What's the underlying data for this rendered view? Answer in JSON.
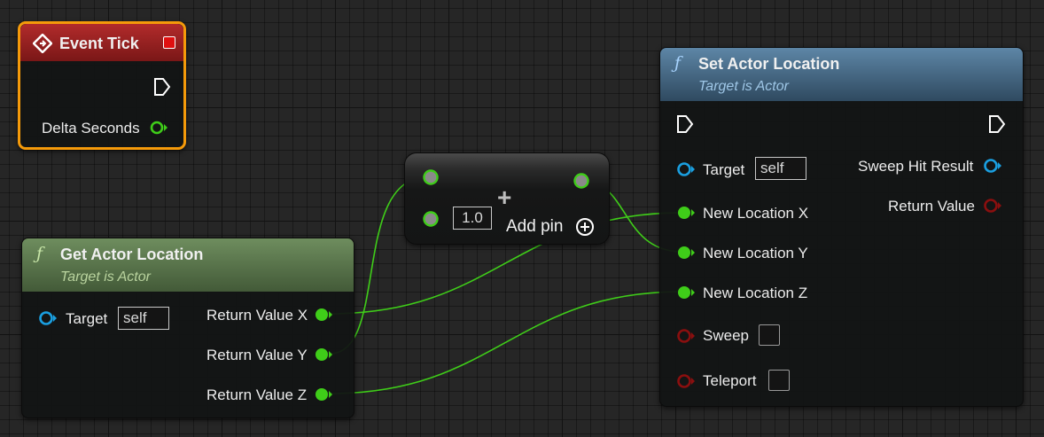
{
  "colors": {
    "float_pin": "#3fcd19",
    "object_pin": "#1a9fe0",
    "bool_pin": "#8a0f0f",
    "event_header": "#8f1f1f",
    "event_highlight": "#f59a0a",
    "func_header": "#4a7090",
    "pure_header": "#5e7a50",
    "wire": "#3fcd19"
  },
  "event_tick": {
    "title": "Event Tick",
    "icon": "event-diamond-icon",
    "pins": {
      "delta_seconds": "Delta Seconds"
    }
  },
  "get_actor_location": {
    "title": "Get Actor Location",
    "subtitle": "Target is Actor",
    "icon": "function-icon",
    "target_label": "Target",
    "target_value": "self",
    "outputs": [
      "Return Value X",
      "Return Value Y",
      "Return Value Z"
    ]
  },
  "add_node": {
    "symbol": "+",
    "input_value": "1.0",
    "add_pin_label": "Add pin"
  },
  "set_actor_location": {
    "title": "Set Actor Location",
    "subtitle": "Target is Actor",
    "icon": "function-icon",
    "target_label": "Target",
    "target_value": "self",
    "inputs": [
      "New Location X",
      "New Location Y",
      "New Location Z"
    ],
    "sweep_label": "Sweep",
    "teleport_label": "Teleport",
    "outputs": {
      "sweep_hit_result": "Sweep Hit Result",
      "return_value": "Return Value"
    }
  }
}
